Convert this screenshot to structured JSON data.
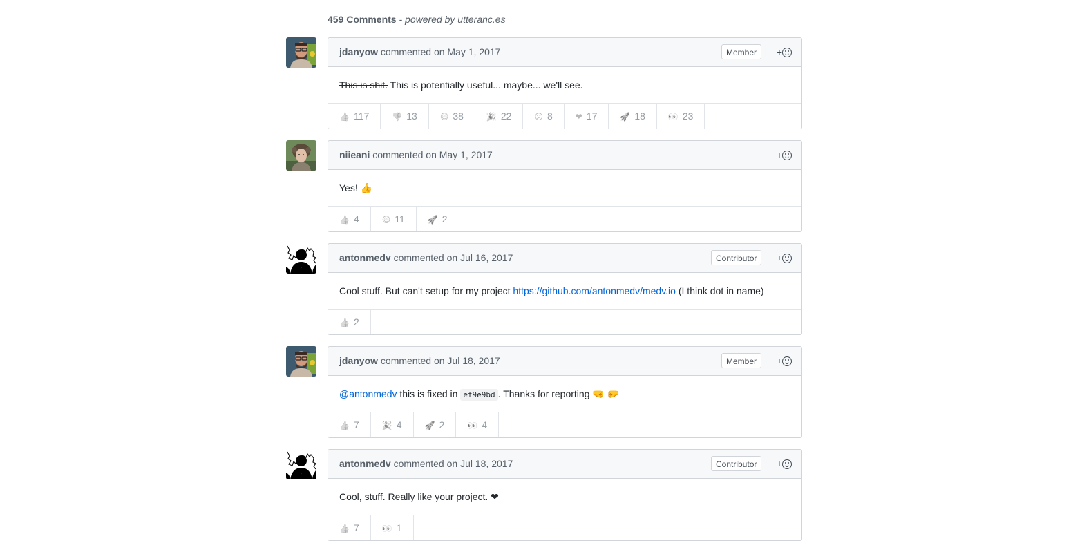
{
  "header": {
    "count": "459 Comments",
    "powered_by": "- powered by utteranc.es"
  },
  "colors": {
    "link": "#0366d6",
    "border": "#d1d5da",
    "header_bg": "#f6f8fa",
    "muted": "#586069"
  },
  "comments": [
    {
      "author": "jdanyow",
      "action": "commented",
      "date": "on May 1, 2017",
      "badge": "Member",
      "avatar": "avatar-photo-bearded-man",
      "body": [
        {
          "type": "strike",
          "text": "This is shit."
        },
        {
          "type": "text",
          "text": " This is potentially useful... maybe... we'll see."
        }
      ],
      "reactions": [
        {
          "icon": "thumbs-up-icon",
          "emoji": "👍",
          "count": "117"
        },
        {
          "icon": "thumbs-down-icon",
          "emoji": "👎",
          "count": "13"
        },
        {
          "icon": "laugh-icon",
          "emoji": "😄",
          "count": "38"
        },
        {
          "icon": "hooray-icon",
          "emoji": "🎉",
          "count": "22"
        },
        {
          "icon": "confused-icon",
          "emoji": "😕",
          "count": "8"
        },
        {
          "icon": "heart-icon",
          "emoji": "❤",
          "count": "17"
        },
        {
          "icon": "rocket-icon",
          "emoji": "🚀",
          "count": "18"
        },
        {
          "icon": "eyes-icon",
          "emoji": "👀",
          "count": "23"
        }
      ]
    },
    {
      "author": "niieani",
      "action": "commented",
      "date": "on May 1, 2017",
      "badge": "",
      "avatar": "avatar-photo-curly-hair",
      "body": [
        {
          "type": "text",
          "text": "Yes! 👍"
        }
      ],
      "reactions": [
        {
          "icon": "thumbs-up-icon",
          "emoji": "👍",
          "count": "4"
        },
        {
          "icon": "laugh-icon",
          "emoji": "😄",
          "count": "11"
        },
        {
          "icon": "rocket-icon",
          "emoji": "🚀",
          "count": "2"
        }
      ]
    },
    {
      "author": "antonmedv",
      "action": "commented",
      "date": "on Jul 16, 2017",
      "badge": "Contributor",
      "avatar": "avatar-silhouette",
      "body": [
        {
          "type": "text",
          "text": "Cool stuff. But can't setup for my project "
        },
        {
          "type": "link",
          "text": "https://github.com/antonmedv/medv.io"
        },
        {
          "type": "text",
          "text": " (I think dot in name)"
        }
      ],
      "reactions": [
        {
          "icon": "thumbs-up-icon",
          "emoji": "👍",
          "count": "2"
        }
      ]
    },
    {
      "author": "jdanyow",
      "action": "commented",
      "date": "on Jul 18, 2017",
      "badge": "Member",
      "avatar": "avatar-photo-bearded-man",
      "body": [
        {
          "type": "mention",
          "text": "@antonmedv"
        },
        {
          "type": "text",
          "text": " this is fixed in "
        },
        {
          "type": "code",
          "text": "ef9e9bd"
        },
        {
          "type": "text",
          "text": ". Thanks for reporting 🤜 🤛"
        }
      ],
      "reactions": [
        {
          "icon": "thumbs-up-icon",
          "emoji": "👍",
          "count": "7"
        },
        {
          "icon": "hooray-icon",
          "emoji": "🎉",
          "count": "4"
        },
        {
          "icon": "rocket-icon",
          "emoji": "🚀",
          "count": "2"
        },
        {
          "icon": "eyes-icon",
          "emoji": "👀",
          "count": "4"
        }
      ]
    },
    {
      "author": "antonmedv",
      "action": "commented",
      "date": "on Jul 18, 2017",
      "badge": "Contributor",
      "avatar": "avatar-silhouette",
      "body": [
        {
          "type": "text",
          "text": "Cool, stuff. Really like your project. ❤"
        }
      ],
      "reactions": [
        {
          "icon": "thumbs-up-icon",
          "emoji": "👍",
          "count": "7"
        },
        {
          "icon": "eyes-icon",
          "emoji": "👀",
          "count": "1"
        }
      ]
    }
  ]
}
